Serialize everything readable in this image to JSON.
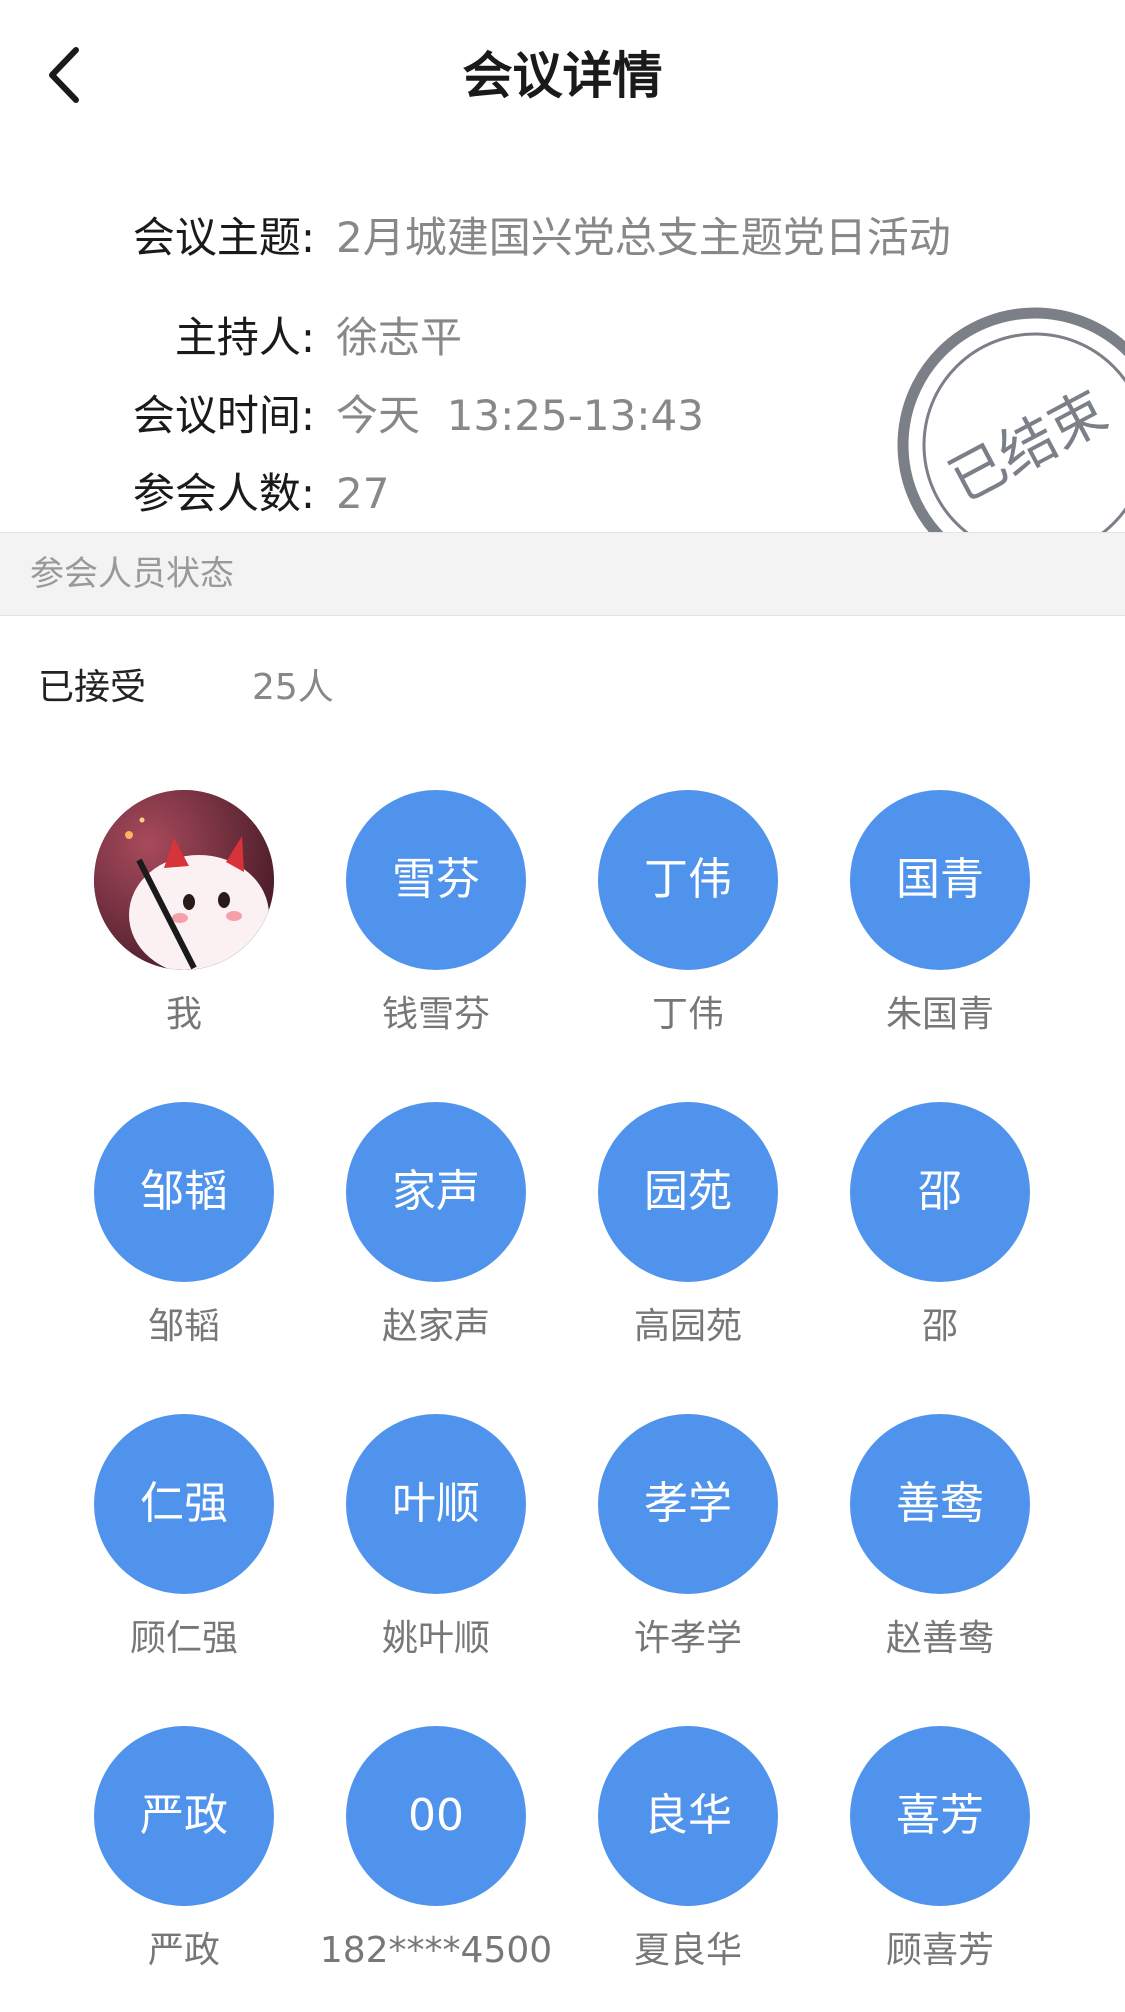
{
  "header": {
    "title": "会议详情",
    "back_icon": "chevron-left-icon"
  },
  "meeting": {
    "topic_label": "会议主题:",
    "topic": "2月城建国兴党总支主题党日活动",
    "host_label": "主持人:",
    "host": "徐志平",
    "time_label": "会议时间:",
    "time": "今天  13:25-13:43",
    "count_label": "参会人数:",
    "count": "27",
    "status_stamp": "已结束"
  },
  "section": {
    "title": "参会人员状态"
  },
  "accepted": {
    "label": "已接受",
    "count": "25人"
  },
  "colors": {
    "avatar_blue": "#4f93ec",
    "stamp_gray": "#7a7f88"
  },
  "members": [
    {
      "avatar": "",
      "name": "我",
      "photo": true
    },
    {
      "avatar": "雪芬",
      "name": "钱雪芬"
    },
    {
      "avatar": "丁伟",
      "name": "丁伟"
    },
    {
      "avatar": "国青",
      "name": "朱国青"
    },
    {
      "avatar": "邹韬",
      "name": "邹韬"
    },
    {
      "avatar": "家声",
      "name": "赵家声"
    },
    {
      "avatar": "园苑",
      "name": "高园苑"
    },
    {
      "avatar": "邵",
      "name": "邵"
    },
    {
      "avatar": "仁强",
      "name": "顾仁强"
    },
    {
      "avatar": "叶顺",
      "name": "姚叶顺"
    },
    {
      "avatar": "孝学",
      "name": "许孝学"
    },
    {
      "avatar": "善鸯",
      "name": "赵善鸯"
    },
    {
      "avatar": "严政",
      "name": "严政"
    },
    {
      "avatar": "00",
      "name": "182****4500"
    },
    {
      "avatar": "良华",
      "name": "夏良华"
    },
    {
      "avatar": "喜芳",
      "name": "顾喜芳"
    }
  ]
}
